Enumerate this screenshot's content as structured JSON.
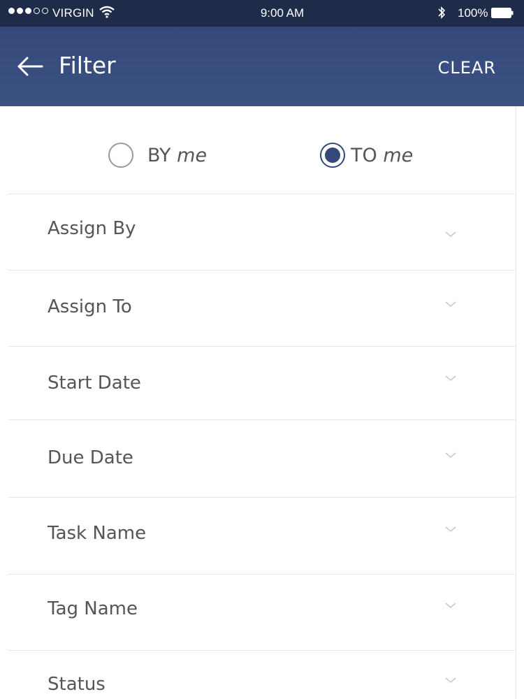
{
  "status_bar": {
    "carrier": "VIRGIN",
    "time": "9:00 AM",
    "battery": "100%"
  },
  "app_bar": {
    "title": "Filter",
    "clear_label": "CLEAR",
    "back_icon": "arrow-left-icon"
  },
  "toggle": {
    "by": {
      "prefix": "BY",
      "emph": "me",
      "selected": false
    },
    "to": {
      "prefix": "TO",
      "emph": "me",
      "selected": true
    }
  },
  "filters": [
    {
      "label": "Assign By"
    },
    {
      "label": "Assign To"
    },
    {
      "label": "Start Date"
    },
    {
      "label": "Due Date"
    },
    {
      "label": "Task Name"
    },
    {
      "label": "Tag Name"
    },
    {
      "label": "Status"
    }
  ],
  "colors": {
    "accent": "#34497a",
    "status_bar": "#1e2b49",
    "text": "#555555"
  }
}
